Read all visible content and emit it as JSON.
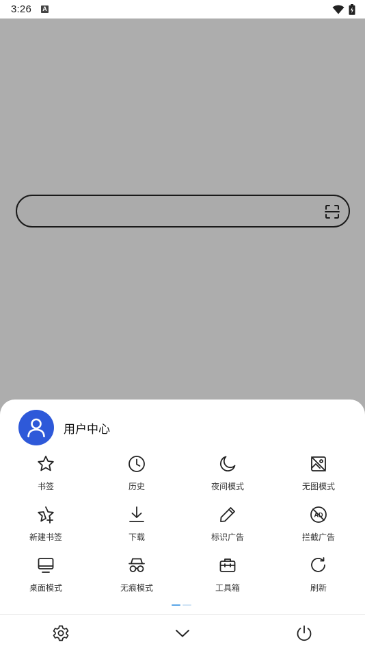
{
  "status_bar": {
    "time": "3:26",
    "notification_badge": "A"
  },
  "search": {
    "value": ""
  },
  "user": {
    "name": "用户中心",
    "avatar_color": "#2e59d9"
  },
  "menu": {
    "items": [
      {
        "label": "书签",
        "icon": "star-icon"
      },
      {
        "label": "历史",
        "icon": "clock-icon"
      },
      {
        "label": "夜间模式",
        "icon": "moon-icon"
      },
      {
        "label": "无图模式",
        "icon": "no-image-icon"
      },
      {
        "label": "新建书签",
        "icon": "star-plus-icon"
      },
      {
        "label": "下载",
        "icon": "download-icon"
      },
      {
        "label": "标识广告",
        "icon": "pencil-icon"
      },
      {
        "label": "拦截广告",
        "icon": "ad-block-icon"
      },
      {
        "label": "桌面模式",
        "icon": "monitor-icon"
      },
      {
        "label": "无痕模式",
        "icon": "incognito-icon"
      },
      {
        "label": "工具箱",
        "icon": "toolbox-icon"
      },
      {
        "label": "刷新",
        "icon": "refresh-icon"
      }
    ]
  },
  "pagination": {
    "current_page": 1,
    "total_pages": 2,
    "active_color": "#5aa6e8",
    "inactive_color": "#cfe3f5"
  },
  "bottom_bar": {
    "left": "gear-icon",
    "center": "chevron-down-icon",
    "right": "power-icon"
  }
}
